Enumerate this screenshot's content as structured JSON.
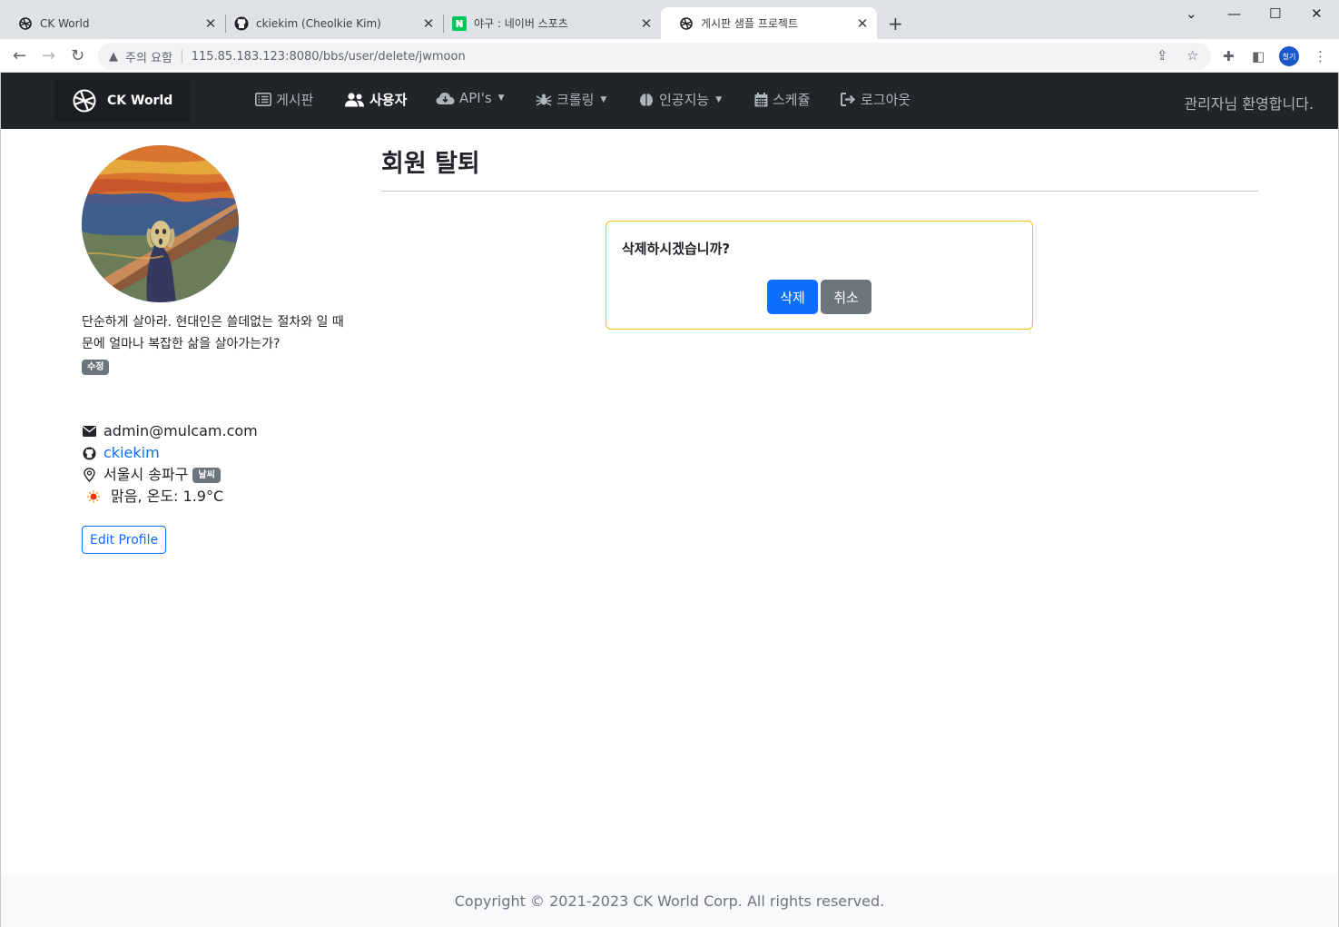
{
  "browser": {
    "tabs": [
      {
        "title": "CK World",
        "icon": "globe-favicon",
        "active": false
      },
      {
        "title": "ckiekim (Cheolkie Kim)",
        "icon": "github-favicon",
        "active": false
      },
      {
        "title": "야구 : 네이버 스포츠",
        "icon": "naver-favicon",
        "active": false
      },
      {
        "title": "게시판 샘플 프로젝트",
        "icon": "globe-favicon",
        "active": true
      }
    ],
    "security_label": "주의 요함",
    "url": "115.85.183.123:8080/bbs/user/delete/jwmoon",
    "profile_label": "철기"
  },
  "navbar": {
    "brand": "CK World",
    "items": [
      {
        "label": "게시판",
        "icon": "list-icon",
        "dropdown": false,
        "active": false
      },
      {
        "label": "사용자",
        "icon": "users-icon",
        "dropdown": false,
        "active": true
      },
      {
        "label": "API's",
        "icon": "cloud-icon",
        "dropdown": true,
        "active": false
      },
      {
        "label": "크롤링",
        "icon": "spider-icon",
        "dropdown": true,
        "active": false
      },
      {
        "label": "인공지능",
        "icon": "brain-icon",
        "dropdown": true,
        "active": false
      },
      {
        "label": "스케쥴",
        "icon": "calendar-icon",
        "dropdown": false,
        "active": false
      },
      {
        "label": "로그아웃",
        "icon": "logout-icon",
        "dropdown": false,
        "active": false
      }
    ],
    "welcome": "관리자님 환영합니다."
  },
  "profile": {
    "bio": "단순하게 살아라. 현대인은 쓸데없는 절차와 일 때문에 얼마나 복잡한 삶을 살아가는가?",
    "edit_badge": "수정",
    "email": "admin@mulcam.com",
    "github": "ckiekim",
    "location": "서울시 송파구",
    "weather_badge": "날씨",
    "weather": "맑음, 온도: 1.9°C",
    "edit_profile_label": "Edit Profile"
  },
  "main": {
    "title": "회원 탈퇴",
    "confirm_question": "삭제하시겠습니까?",
    "delete_label": "삭제",
    "cancel_label": "취소"
  },
  "footer": {
    "copyright": "Copyright © 2021-2023 CK World Corp. All rights reserved."
  },
  "colors": {
    "primary": "#0d6efd",
    "secondary": "#6c757d",
    "warning_border": "#ffc107",
    "navbar_bg": "#212529"
  }
}
